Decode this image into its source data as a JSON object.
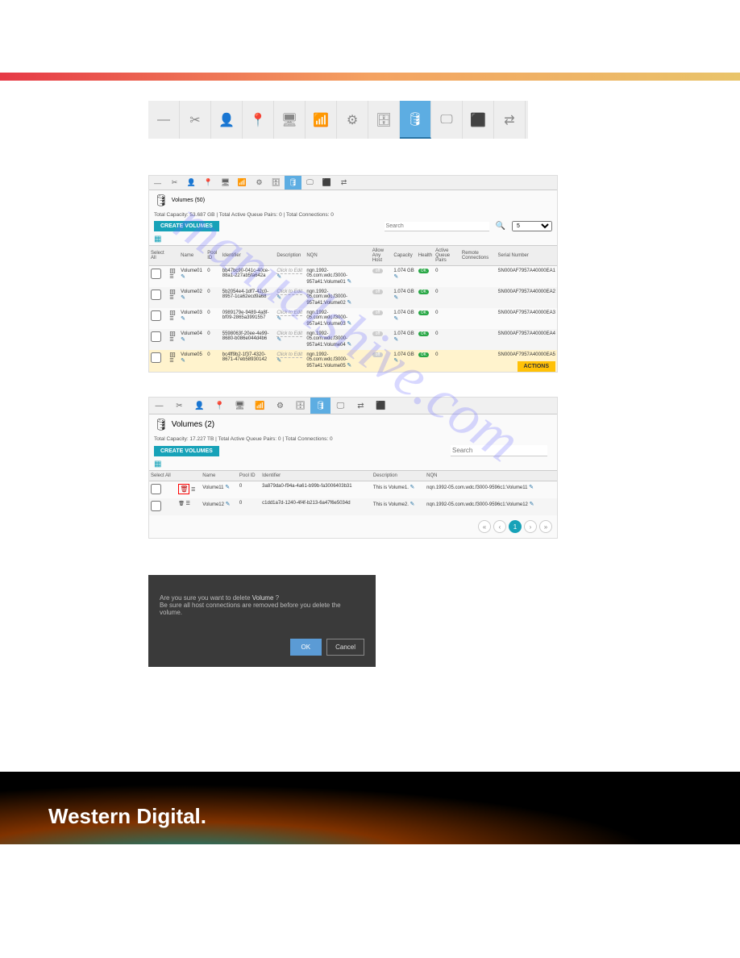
{
  "gradient": true,
  "toolbar_icons": [
    "—",
    "✂",
    "👤",
    "📍",
    "🖥",
    "📶",
    "⚙",
    "🗄",
    "🛢",
    "🖵",
    "⬛",
    "⇄"
  ],
  "toolbar_active_index": 8,
  "panel1": {
    "title": "Volumes (50)",
    "stats": "Total Capacity: 53.687 GB | Total Active Queue Pairs: 0 | Total Connections: 0",
    "create_btn": "CREATE VOLUMES",
    "search_placeholder": "Search",
    "page_size": "5",
    "headers": [
      "Select All",
      "",
      "Name",
      "Pool ID",
      "Identifier",
      "Description",
      "NQN",
      "Allow Any Host",
      "Capacity",
      "Health",
      "Active Queue Pairs",
      "Remote Connections",
      "Serial Number"
    ],
    "rows": [
      {
        "name": "Volume01",
        "pool": "0",
        "identifier": "bb47bc90-041c-40ce-88a1-227ab5fa642a",
        "nqn": "nqn.1992-05.com.wdc.f3000-957a41:Volume01",
        "capacity": "1.074 GB",
        "pairs": "0",
        "serial": "SN000AF7957A40000EA1",
        "alt": false
      },
      {
        "name": "Volume02",
        "pool": "0",
        "identifier": "5b2054e4-1df7-42c0-8957-1ca62ecd9a68",
        "nqn": "nqn.1992-05.com.wdc.f3000-957a41:Volume02",
        "capacity": "1.074 GB",
        "pairs": "0",
        "serial": "SN000AF7957A40000EA2",
        "alt": true
      },
      {
        "name": "Volume03",
        "pool": "0",
        "identifier": "0989179e-9489-4a8f-bf09-2865a3991557",
        "nqn": "nqn.1992-05.com.wdc.f3000-957a41:Volume03",
        "capacity": "1.074 GB",
        "pairs": "0",
        "serial": "SN000AF7957A40000EA3",
        "alt": false
      },
      {
        "name": "Volume04",
        "pool": "0",
        "identifier": "5598063f-20ee-4e99-8680-b086e044d4b6",
        "nqn": "nqn.1992-05.com.wdc.f3000-957a41:Volume04",
        "capacity": "1.074 GB",
        "pairs": "0",
        "serial": "SN000AF7957A40000EA4",
        "alt": true
      },
      {
        "name": "Volume05",
        "pool": "0",
        "identifier": "bc4ff9b2-1f37-4320-8671-47eb58930142",
        "nqn": "nqn.1992-05.com.wdc.f3000-957a41:Volume05",
        "capacity": "1.074 GB",
        "pairs": "0",
        "serial": "SN000AF7957A40000EA5",
        "alt": false,
        "highlight": true
      }
    ],
    "actions_label": "ACTIONS",
    "click_to_edit": "Click to Edit",
    "badge_ok": "OK"
  },
  "panel2": {
    "title": "Volumes (2)",
    "stats": "Total Capacity: 17.227 TB | Total Active Queue Pairs: 0 | Total Connections: 0",
    "create_btn": "CREATE VOLUMES",
    "search_placeholder": "Search",
    "headers": [
      "Select All",
      "",
      "Name",
      "Pool ID",
      "Identifier",
      "Description",
      "NQN"
    ],
    "rows": [
      {
        "name": "Volume11",
        "pool": "0",
        "identifier": "3a879da0-f94a-4a61-b99b-fa3006403b31",
        "desc": "This is Volume1.",
        "nqn": "nqn.1992-05.com.wdc.f3000-9596c1:Volume11",
        "trash": true
      },
      {
        "name": "Volume12",
        "pool": "0",
        "identifier": "c1dd1a7d-1240-4f4f-b213-6a47f6e5034d",
        "desc": "This is Volume2.",
        "nqn": "nqn.1992-05.com.wdc.f3000-9596c1:Volume12",
        "trash": false
      }
    ],
    "page_current": "1"
  },
  "dialog": {
    "line1_a": "Are you sure you want to delete ",
    "line1_b": "Volume",
    "line1_c": " ?",
    "line2": "Be sure all host connections are removed before you delete the volume.",
    "ok": "OK",
    "cancel": "Cancel"
  },
  "footer": {
    "brand": "Western Digital."
  },
  "watermark": "manualshive.com"
}
